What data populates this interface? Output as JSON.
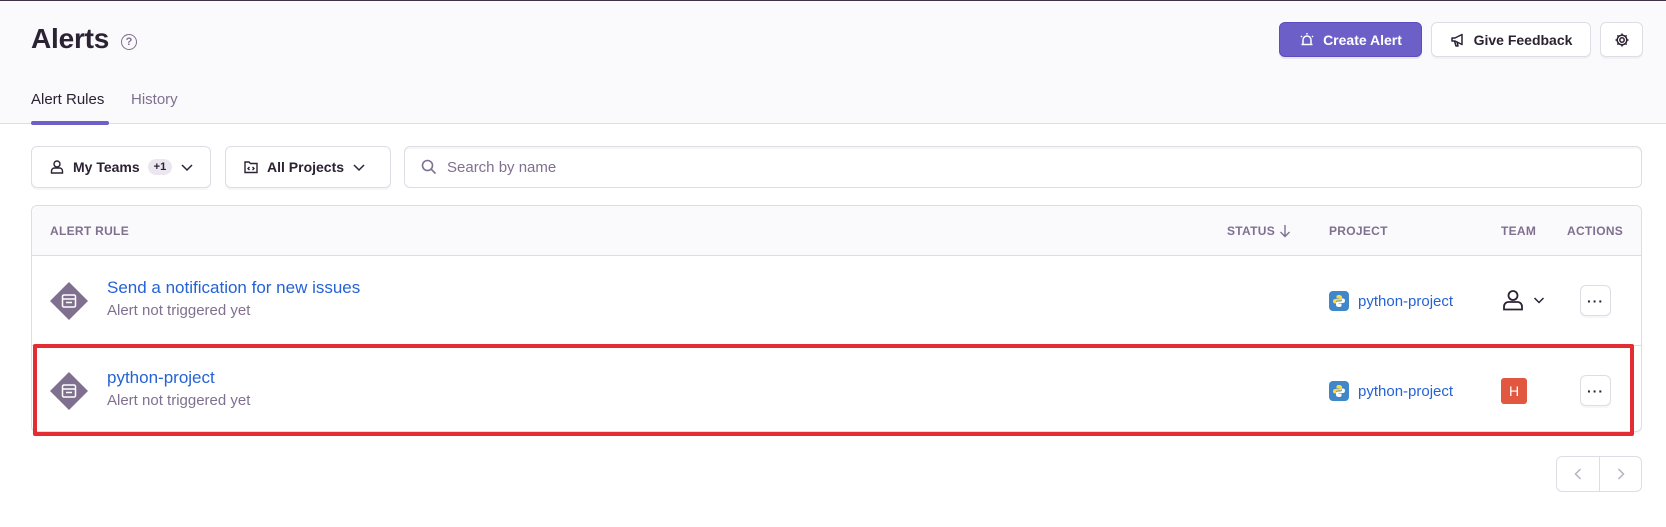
{
  "header": {
    "title": "Alerts",
    "help_glyph": "?",
    "create_alert_label": "Create Alert",
    "give_feedback_label": "Give Feedback"
  },
  "tabs": [
    {
      "label": "Alert Rules",
      "active": true
    },
    {
      "label": "History",
      "active": false
    }
  ],
  "filters": {
    "teams_label": "My Teams",
    "teams_badge": "+1",
    "projects_label": "All Projects",
    "search_placeholder": "Search by name",
    "search_value": ""
  },
  "table": {
    "columns": {
      "rule": "ALERT RULE",
      "status": "STATUS",
      "project": "PROJECT",
      "team": "TEAM",
      "actions": "ACTIONS"
    },
    "rows": [
      {
        "name": "Send a notification for new issues",
        "status": "Alert not triggered yet",
        "project": "python-project",
        "team": "unassigned-icon",
        "actions_glyph": "···"
      },
      {
        "name": "python-project",
        "status": "Alert not triggered yet",
        "project": "python-project",
        "team": "H",
        "actions_glyph": "···"
      }
    ]
  },
  "colors": {
    "accent": "#6c5fc7",
    "link": "#2562d4",
    "highlight": "#e42c33",
    "team_avatar": "#e2573f",
    "rule_icon": "#80708f"
  },
  "icons": {
    "create_alert": "siren-icon",
    "feedback": "megaphone-icon",
    "settings": "gear-icon",
    "teams": "user-icon",
    "projects": "project-icon",
    "search": "search-icon",
    "sort": "arrow-down-icon",
    "project_platform": "python-icon"
  }
}
